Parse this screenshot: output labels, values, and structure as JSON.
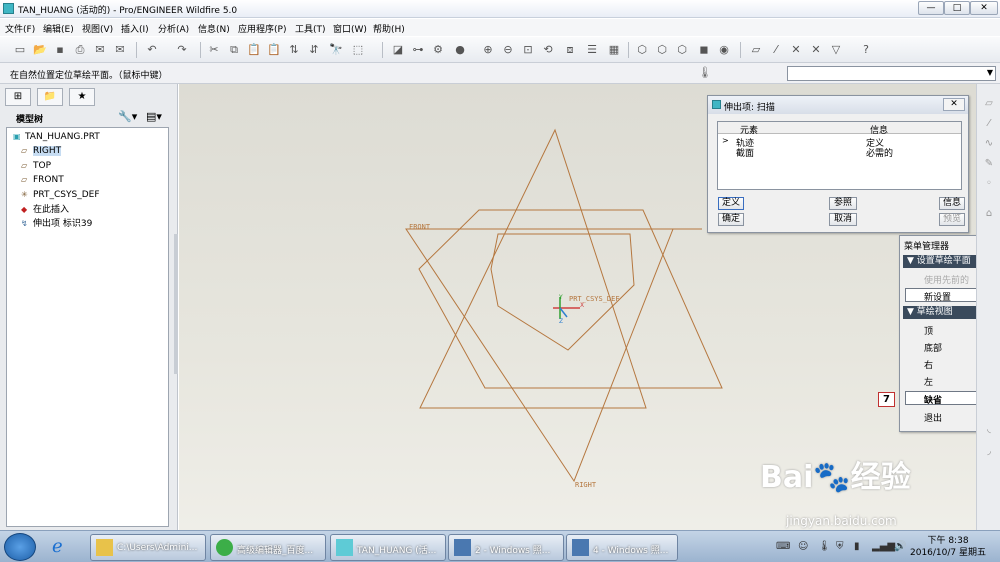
{
  "window": {
    "title": "TAN_HUANG (活动的) - Pro/ENGINEER Wildfire 5.0",
    "min": "—",
    "max": "□",
    "close": "✕"
  },
  "menu": [
    "文件(F)",
    "编辑(E)",
    "视图(V)",
    "插入(I)",
    "分析(A)",
    "信息(N)",
    "应用程序(P)",
    "工具(T)",
    "窗口(W)",
    "帮助(H)"
  ],
  "message": "在自然位置定位草绘平面。（鼠标中键）",
  "model_tree": {
    "title": "模型树",
    "nodes": [
      {
        "label": "TAN_HUANG.PRT",
        "icon": "part-icon"
      },
      {
        "label": "RIGHT",
        "icon": "datum-plane-icon"
      },
      {
        "label": "TOP",
        "icon": "datum-plane-icon"
      },
      {
        "label": "FRONT",
        "icon": "datum-plane-icon"
      },
      {
        "label": "PRT_CSYS_DEF",
        "icon": "csys-icon"
      },
      {
        "label": "在此插入",
        "icon": "insert-here-icon"
      },
      {
        "label": "伸出项 标识39",
        "icon": "protrusion-icon"
      }
    ]
  },
  "canvas": {
    "front": "FRONT",
    "right": "RIGHT",
    "csys": "PRT_CSYS_DEF",
    "x": "X",
    "z": "Z",
    "y": "Y"
  },
  "dialog": {
    "title": "伸出项: 扫描",
    "col_element": "元素",
    "col_info": "信息",
    "rows": [
      {
        "element": "轨迹",
        "info": "定义"
      },
      {
        "element": "截面",
        "info": "必需的"
      }
    ],
    "buttons": {
      "define": "定义",
      "refs": "参照",
      "info": "信息",
      "ok": "确定",
      "cancel": "取消",
      "preview": "预览"
    }
  },
  "menu_manager": {
    "title": "菜单管理器",
    "sec1": "设置草绘平面",
    "use_prev": "使用先前的",
    "new_setup": "新设置",
    "sec2": "草绘视图",
    "items": [
      "顶",
      "底部",
      "右",
      "左"
    ],
    "default": "缺省",
    "exit": "退出"
  },
  "selection_count": "7",
  "taskbar": {
    "buttons": [
      "C:\\Users\\Admini...",
      "高级编辑器_百度...",
      "TAN_HUANG (活...",
      "2 - Windows 照...",
      "4 - Windows 照..."
    ],
    "time": "下午 8:38",
    "date": "2016/10/7 星期五"
  },
  "watermark": {
    "brand": "Bai🐾经验",
    "url": "jingyan.baidu.com"
  }
}
